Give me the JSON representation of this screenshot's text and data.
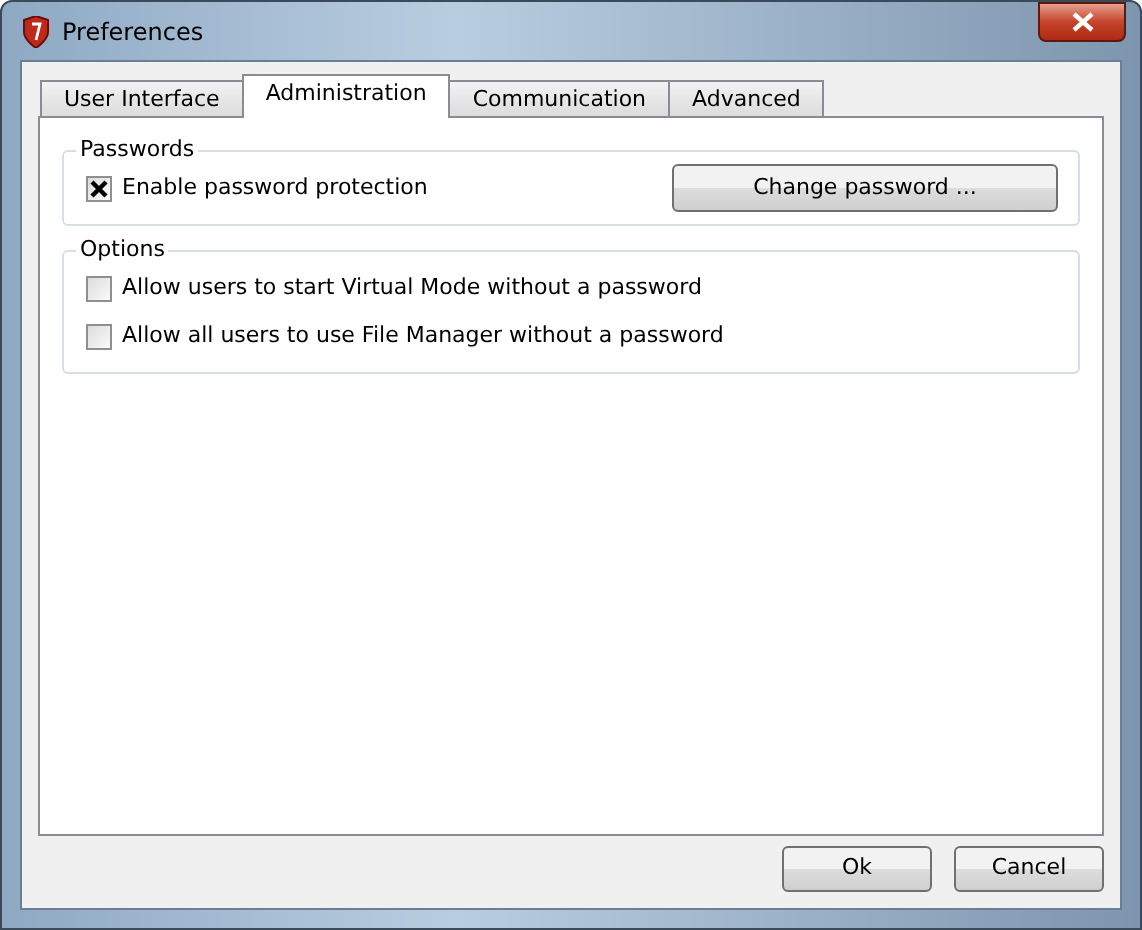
{
  "window": {
    "title": "Preferences"
  },
  "tabs": [
    {
      "label": "User Interface",
      "selected": false
    },
    {
      "label": "Administration",
      "selected": true
    },
    {
      "label": "Communication",
      "selected": false
    },
    {
      "label": "Advanced",
      "selected": false
    }
  ],
  "groups": [
    {
      "title": "Passwords",
      "items": [
        {
          "kind": "checkbox",
          "label": "Enable password protection",
          "checked": true
        },
        {
          "kind": "button",
          "label": "Change password ..."
        }
      ]
    },
    {
      "title": "Options",
      "items": [
        {
          "kind": "checkbox",
          "label": "Allow users to start Virtual Mode without a password",
          "checked": false
        },
        {
          "kind": "checkbox",
          "label": "Allow all users to use File Manager without a password",
          "checked": false
        }
      ]
    }
  ],
  "buttons": [
    "Ok",
    "Cancel"
  ]
}
